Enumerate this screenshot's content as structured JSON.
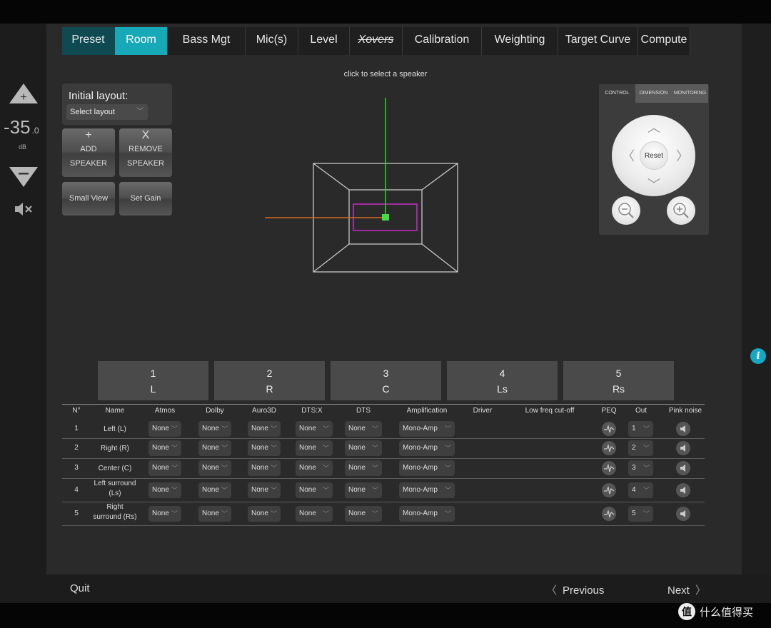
{
  "tabs": [
    {
      "label": "Preset",
      "state": "preset"
    },
    {
      "label": "Room",
      "state": "active"
    },
    {
      "label": "Bass Mgt",
      "state": ""
    },
    {
      "label": "Mic(s)",
      "state": ""
    },
    {
      "label": "Level",
      "state": ""
    },
    {
      "label": "Xovers",
      "state": "strike"
    },
    {
      "label": "Calibration",
      "state": ""
    },
    {
      "label": "Weighting",
      "state": ""
    },
    {
      "label": "Target Curve",
      "state": ""
    },
    {
      "label": "Compute",
      "state": ""
    }
  ],
  "hint": "click to select a speaker",
  "volume": {
    "value": "-35",
    "decimal": ".0",
    "unit": "dB"
  },
  "layout": {
    "title": "Initial layout:",
    "select_placeholder": "Select layout"
  },
  "buttons": {
    "add": {
      "symbol": "+",
      "line1": "ADD",
      "line2": "SPEAKER"
    },
    "remove": {
      "symbol": "X",
      "line1": "REMOVE",
      "line2": "SPEAKER"
    },
    "small_view": "Small View",
    "set_gain": "Set Gain"
  },
  "nav": {
    "tabs": [
      "CONTROL",
      "DIMENSION",
      "MONITORING"
    ],
    "reset": "Reset"
  },
  "speaker_tiles": [
    {
      "num": "1",
      "label": "L"
    },
    {
      "num": "2",
      "label": "R"
    },
    {
      "num": "3",
      "label": "C"
    },
    {
      "num": "4",
      "label": "Ls"
    },
    {
      "num": "5",
      "label": "Rs"
    }
  ],
  "table": {
    "headers": [
      "N°",
      "Name",
      "Atmos",
      "Dolby",
      "Auro3D",
      "DTS:X",
      "DTS",
      "Amplification",
      "Driver",
      "Low freq cut-off",
      "PEQ",
      "Out",
      "Pink noise"
    ],
    "rows": [
      {
        "n": "1",
        "name1": "Left (L)",
        "name2": "",
        "atmos": "None",
        "dolby": "None",
        "auro": "None",
        "dtsx": "None",
        "dts": "None",
        "amp": "Mono-Amp",
        "out": "1"
      },
      {
        "n": "2",
        "name1": "Right (R)",
        "name2": "",
        "atmos": "None",
        "dolby": "None",
        "auro": "None",
        "dtsx": "None",
        "dts": "None",
        "amp": "Mono-Amp",
        "out": "2"
      },
      {
        "n": "3",
        "name1": "Center (C)",
        "name2": "",
        "atmos": "None",
        "dolby": "None",
        "auro": "None",
        "dtsx": "None",
        "dts": "None",
        "amp": "Mono-Amp",
        "out": "3"
      },
      {
        "n": "4",
        "name1": "Left surround",
        "name2": "(Ls)",
        "atmos": "None",
        "dolby": "None",
        "auro": "None",
        "dtsx": "None",
        "dts": "None",
        "amp": "Mono-Amp",
        "out": "4"
      },
      {
        "n": "5",
        "name1": "Right",
        "name2": "surround (Rs)",
        "atmos": "None",
        "dolby": "None",
        "auro": "None",
        "dtsx": "None",
        "dts": "None",
        "amp": "Mono-Amp",
        "out": "5"
      }
    ]
  },
  "footer": {
    "quit": "Quit",
    "previous": "Previous",
    "next": "Next"
  },
  "info_symbol": "i",
  "watermark": {
    "logo": "值",
    "text": "什么值得买"
  },
  "colors": {
    "accent": "#17a9b8",
    "preset_tab": "#0f4a52",
    "info": "#16a7c4"
  }
}
